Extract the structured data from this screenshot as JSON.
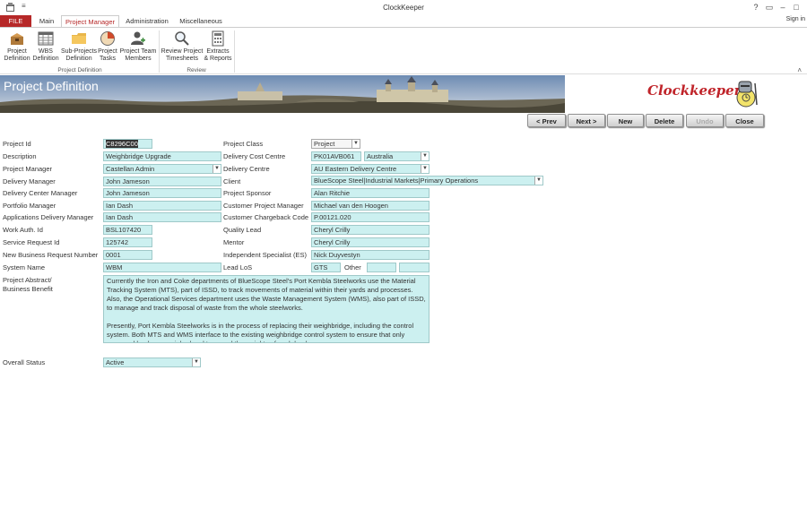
{
  "window": {
    "title": "ClockKeeper",
    "qat": "≡",
    "help": "?",
    "restore": "▭",
    "minimize": "–",
    "maximize": "□",
    "close": "✕",
    "sign_in": "Sign in"
  },
  "tabs": [
    {
      "label": "FILE"
    },
    {
      "label": "Main"
    },
    {
      "label": "Project Manager"
    },
    {
      "label": "Administration"
    },
    {
      "label": "Miscellaneous"
    }
  ],
  "ribbon": {
    "groups": [
      {
        "label": "Project Definition",
        "buttons": [
          {
            "line1": "Project",
            "line2": "Definition",
            "icon": "project-box-icon"
          },
          {
            "line1": "WBS",
            "line2": "Definition",
            "icon": "grid-icon"
          },
          {
            "line1": "Sub-Projects",
            "line2": "Definition",
            "icon": "folder-icon"
          },
          {
            "line1": "Project",
            "line2": "Tasks",
            "icon": "pie-icon"
          },
          {
            "line1": "Project Team",
            "line2": "Members",
            "icon": "user-add-icon"
          }
        ]
      },
      {
        "label": "Review",
        "buttons": [
          {
            "line1": "Review Project",
            "line2": "Timesheets",
            "icon": "magnifier-icon"
          },
          {
            "line1": "Extracts",
            "line2": "& Reports",
            "icon": "calculator-icon"
          }
        ]
      }
    ],
    "collapse": "˄"
  },
  "banner": {
    "title": "Project Definition",
    "logo": "Clockkeeper"
  },
  "nav": [
    {
      "label": "< Prev"
    },
    {
      "label": "Next >"
    },
    {
      "label": "New"
    },
    {
      "label": "Delete"
    },
    {
      "label": "Undo"
    },
    {
      "label": "Close"
    }
  ],
  "form": {
    "project_id": {
      "label": "Project Id",
      "value": "C8296C00"
    },
    "description": {
      "label": "Description",
      "value": "Weighbridge Upgrade"
    },
    "project_manager": {
      "label": "Project Manager",
      "value": "Castellan Admin"
    },
    "delivery_manager": {
      "label": "Delivery Manager",
      "value": "John Jameson"
    },
    "delivery_center_manager": {
      "label": "Delivery Center Manager",
      "value": "John Jameson"
    },
    "portfolio_manager": {
      "label": "Portfolio Manager",
      "value": "Ian Dash"
    },
    "applications_delivery_manager": {
      "label": "Applications Delivery Manager",
      "value": "Ian Dash"
    },
    "work_auth_id": {
      "label": "Work Auth. Id",
      "value": "BSL107420"
    },
    "service_request_id": {
      "label": "Service Request Id",
      "value": "125742"
    },
    "new_business_request_number": {
      "label": "New Business Request Number",
      "value": "0001"
    },
    "system_name": {
      "label": "System Name",
      "value": "WBM"
    },
    "project_abstract": {
      "label1": "Project Abstract/",
      "label2": "Business Benefit",
      "para1": "Currently the Iron and Coke departments of BlueScope Steel's Port Kembla Steelworks use the Material Tracking System (MTS), part of ISSD, to track movements of material within their yards and processes. Also, the Operational Services department uses the Waste Management System (WMS), also part of ISSD, to manage and track disposal of waste from the whole steelworks.",
      "para2": "Presently, Port Kembla Steelworks is in the process of replacing their weighbridge, including the control system. Both MTS and WMS interface to the existing weighbridge control system to ensure that only approved loads are weighed and to record the weights of each load."
    },
    "overall_status": {
      "label": "Overall Status",
      "value": "Active"
    },
    "project_class": {
      "label": "Project Class",
      "value": "Project"
    },
    "delivery_cost_centre": {
      "label": "Delivery Cost Centre",
      "value": "PK01AVB061",
      "country": "Australia"
    },
    "delivery_centre": {
      "label": "Delivery Centre",
      "value": "AU Eastern Delivery Centre"
    },
    "client": {
      "label": "Client",
      "value": "BlueScope Steel|Industrial Markets|Primary Operations"
    },
    "project_sponsor": {
      "label": "Project Sponsor",
      "value": "Alan Ritchie"
    },
    "customer_project_manager": {
      "label": "Customer Project Manager",
      "value": "Michael van den Hoogen"
    },
    "customer_chargeback_code": {
      "label": "Customer Chargeback Code",
      "value": "P.00121.020"
    },
    "quality_lead": {
      "label": "Quality Lead",
      "value": "Cheryl Crilly"
    },
    "mentor": {
      "label": "Mentor",
      "value": "Cheryl Crilly"
    },
    "independent_specialist": {
      "label": "Independent Specialist (ES)",
      "value": "Nick Duyvestyn"
    },
    "lead_los": {
      "label": "Lead LoS",
      "value": "GTS",
      "other_label": "Other",
      "other1": "",
      "other2": ""
    }
  },
  "colors": {
    "accent": "#b62828",
    "field_bg": "#ccf0f0",
    "logo": "#c0242a"
  }
}
